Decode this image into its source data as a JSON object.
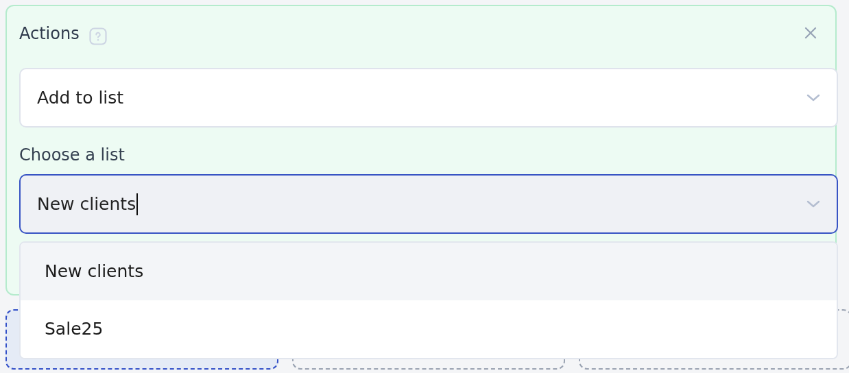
{
  "panel": {
    "title": "Actions",
    "action_select": {
      "value": "Add to list"
    },
    "list_label": "Choose a list",
    "list_field": {
      "value": "New clients",
      "focused": true
    },
    "options": [
      {
        "label": "New clients",
        "highlighted": true
      },
      {
        "label": "Sale25",
        "highlighted": false
      }
    ]
  },
  "drop_zones": [
    {
      "selected": true
    },
    {
      "selected": false
    },
    {
      "selected": false
    }
  ]
}
